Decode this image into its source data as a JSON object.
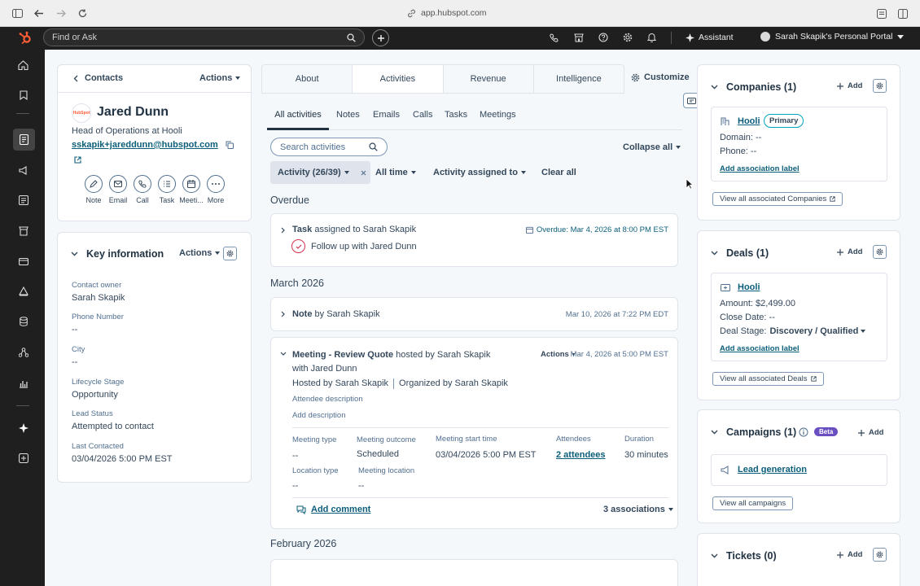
{
  "browser": {
    "url": "app.hubspot.com"
  },
  "topbar": {
    "search_placeholder": "Find or Ask",
    "assistant_label": "Assistant",
    "portal_label": "Sarah Skapik's Personal Portal"
  },
  "left_col": {
    "contacts_back": "Contacts",
    "actions_label": "Actions",
    "contact": {
      "name": "Jared Dunn",
      "logo_text": "HubSpot",
      "title": "Head of Operations at Hooli",
      "email": "sskapik+jareddunn@hubspot.com"
    },
    "quick_actions": [
      "Note",
      "Email",
      "Call",
      "Task",
      "Meeti...",
      "More"
    ],
    "key_info": {
      "title": "Key information",
      "actions_label": "Actions",
      "fields": [
        {
          "label": "Contact owner",
          "value": "Sarah Skapik"
        },
        {
          "label": "Phone Number",
          "value": "--"
        },
        {
          "label": "City",
          "value": "--"
        },
        {
          "label": "Lifecycle Stage",
          "value": "Opportunity"
        },
        {
          "label": "Lead Status",
          "value": "Attempted to contact"
        },
        {
          "label": "Last Contacted",
          "value": "03/04/2026 5:00 PM EST"
        }
      ]
    }
  },
  "middle": {
    "tabs": [
      "About",
      "Activities",
      "Revenue",
      "Intelligence"
    ],
    "customize_label": "Customize",
    "subtabs": [
      "All activities",
      "Notes",
      "Emails",
      "Calls",
      "Tasks",
      "Meetings"
    ],
    "search_placeholder": "Search activities",
    "collapse_all": "Collapse all",
    "filters": {
      "activity": "Activity (26/39)",
      "time": "All time",
      "assigned": "Activity assigned to",
      "clear": "Clear all"
    },
    "overdue_heading": "Overdue",
    "task": {
      "type": "Task",
      "assigned_text": "assigned to Sarah Skapik",
      "due": "Overdue: Mar 4, 2026 at 8:00 PM EST",
      "description": "Follow up with Jared Dunn"
    },
    "march_heading": "March 2026",
    "note": {
      "type": "Note",
      "by": "by Sarah Skapik",
      "date": "Mar 10, 2026 at 7:22 PM EDT"
    },
    "meeting": {
      "type": "Meeting",
      "title": "- Review Quote",
      "hosted": "hosted by Sarah Skapik",
      "with": "with Jared Dunn",
      "actions_label": "Actions",
      "date": "Mar 4, 2026 at 5:00 PM EST",
      "hosted_by": "Hosted by Sarah Skapik",
      "organized_by": "Organized by Sarah Skapik",
      "attendee_desc_label": "Attendee description",
      "add_description": "Add description",
      "fields": [
        {
          "label": "Meeting type",
          "value": "--"
        },
        {
          "label": "Meeting outcome",
          "value": "Scheduled"
        },
        {
          "label": "Meeting start time",
          "value": "03/04/2026 5:00 PM EST"
        },
        {
          "label": "Attendees",
          "value": "2 attendees"
        },
        {
          "label": "Duration",
          "value": "30 minutes"
        },
        {
          "label": "Location type",
          "value": "--"
        },
        {
          "label": "Meeting location",
          "value": "--"
        }
      ],
      "add_comment": "Add comment",
      "associations": "3 associations"
    },
    "feb_heading": "February 2026"
  },
  "right_col": {
    "companies": {
      "title": "Companies (1)",
      "add": "Add",
      "name": "Hooli",
      "badge": "Primary",
      "domain": "Domain: --",
      "phone": "Phone: --",
      "assoc_label": "Add association label",
      "view_all": "View all associated Companies"
    },
    "deals": {
      "title": "Deals (1)",
      "add": "Add",
      "name": "Hooli",
      "amount_label": "Amount:",
      "amount_value": "$2,499.00",
      "close_date": "Close Date: --",
      "stage_label": "Deal Stage:",
      "stage_value": "Discovery / Qualified",
      "assoc_label": "Add association label",
      "view_all": "View all associated Deals"
    },
    "campaigns": {
      "title": "Campaigns (1)",
      "badge": "Beta",
      "add": "Add",
      "name": "Lead generation",
      "view_all": "View all campaigns"
    },
    "tickets": {
      "title": "Tickets (0)",
      "add": "Add"
    }
  },
  "colors": {
    "brand_orange": "#ff5c35",
    "link_teal": "#0b5e7a",
    "dark_nav": "#1f1f1f"
  }
}
